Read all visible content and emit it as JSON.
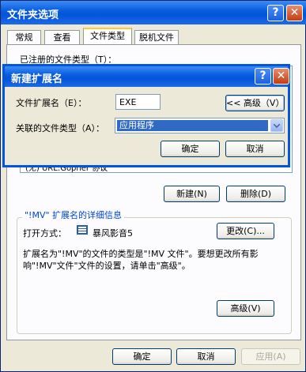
{
  "window": {
    "title": "文件夹选项"
  },
  "tabs": [
    {
      "label": "常规"
    },
    {
      "label": "查看"
    },
    {
      "label": "文件类型"
    },
    {
      "label": "脱机文件"
    }
  ],
  "registered_label": "已注册的文件类型（T）：",
  "list_row_partial": "(无)   URL:Gopher 协议",
  "buttons": {
    "new": "新建(N)",
    "delete": "删除(D)",
    "change": "更改(C)...",
    "advanced": "高级(V)",
    "ok": "确定",
    "cancel": "取消",
    "apply": "应用(A)"
  },
  "details": {
    "title": "\"!MV\" 扩展名的详细信息",
    "opens_with_label": "打开方式：",
    "app_name": "暴风影音5",
    "description": "扩展名为\"!MV\"的文件的类型是\"!MV 文件\"。要想更改所有影响\"!MV\"文件\"文件的设置，请单击\"高级\"。"
  },
  "dialog": {
    "title": "新建扩展名",
    "ext_label": "文件扩展名（E）：",
    "ext_value": "EXE",
    "advanced_button": "<< 高级（V）",
    "type_label": "关联的文件类型（A）：",
    "type_value": "应用程序",
    "ok": "确定",
    "cancel": "取消"
  },
  "colors": {
    "title_blue": "#0454D8",
    "close_red": "#C43D13",
    "selection": "#316AC5",
    "face": "#ECE9D8"
  }
}
